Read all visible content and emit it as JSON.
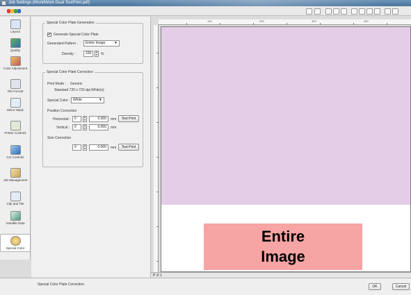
{
  "window": {
    "title": "Job Settings (WorldWork Dual TestPrint.pdf)"
  },
  "sidebar": {
    "items": [
      {
        "label": "Layout",
        "icon": "layout-icon",
        "color": "#2b68b3"
      },
      {
        "label": "Quality",
        "icon": "quality-icon",
        "color": "#4aa84a"
      },
      {
        "label": "Color Adjustment",
        "icon": "color-adjustment-icon",
        "color": "#d08a2c"
      },
      {
        "label": "File Format",
        "icon": "file-format-icon",
        "color": "#7a8ea6"
      },
      {
        "label": "Mirror Mask",
        "icon": "mirror-mask-icon",
        "color": "#3a8fbf"
      },
      {
        "label": "Printer Controls",
        "icon": "printer-controls-icon",
        "color": "#6a8a55"
      },
      {
        "label": "Cut Controls",
        "icon": "cut-controls-icon",
        "color": "#2f6fb8"
      },
      {
        "label": "Job Management",
        "icon": "job-management-icon",
        "color": "#c9a45a"
      },
      {
        "label": "Clip and Tile",
        "icon": "clip-and-tile-icon",
        "color": "#5b7fa8"
      },
      {
        "label": "Variable Data",
        "icon": "variable-data-icon",
        "color": "#4d9a7c"
      },
      {
        "label": "Special Color",
        "icon": "special-color-icon",
        "color": "#d9a23a"
      }
    ]
  },
  "generation": {
    "legend": "Special Color Plate Generation",
    "generate_label": "Generate Special Color Plate",
    "generate_checked": "✔",
    "pattern_label": "Generated Pattern :",
    "pattern_value": "Entire Image",
    "density_label": "Density :",
    "density_value": "100",
    "density_unit": "%"
  },
  "correction": {
    "legend": "Special Color Plate Correction",
    "print_mode_label": "Print Mode :",
    "print_mode_value": "Generic",
    "resolution": "Standard 720 x 720 dpi White(s)",
    "special_color_label": "Special Color :",
    "special_color_value": "White",
    "position_label": "Position Correction",
    "horizontal_label": "Horizontal :",
    "horizontal_value": "0",
    "horizontal_mm": "0.000",
    "vertical_label": "Vertical :",
    "vertical_value": "0",
    "vertical_mm": "0.000",
    "unit_mm": "mm",
    "test_print_label": "Test Print",
    "size_label": "Size Correction",
    "size_value": "0",
    "size_mm": "0.000"
  },
  "preview": {
    "ruler_numbers": [
      "100",
      "200",
      "300",
      "400"
    ],
    "page_indicator": "P  1/  1",
    "overlay_line1": "Entire",
    "overlay_line2": "Image",
    "plate_color": "#e4cde7",
    "overlay_color": "#f6a4a4"
  },
  "footer": {
    "status": "Special Color Plate Correction",
    "ok_label": "OK",
    "cancel_label": "Cancel"
  }
}
